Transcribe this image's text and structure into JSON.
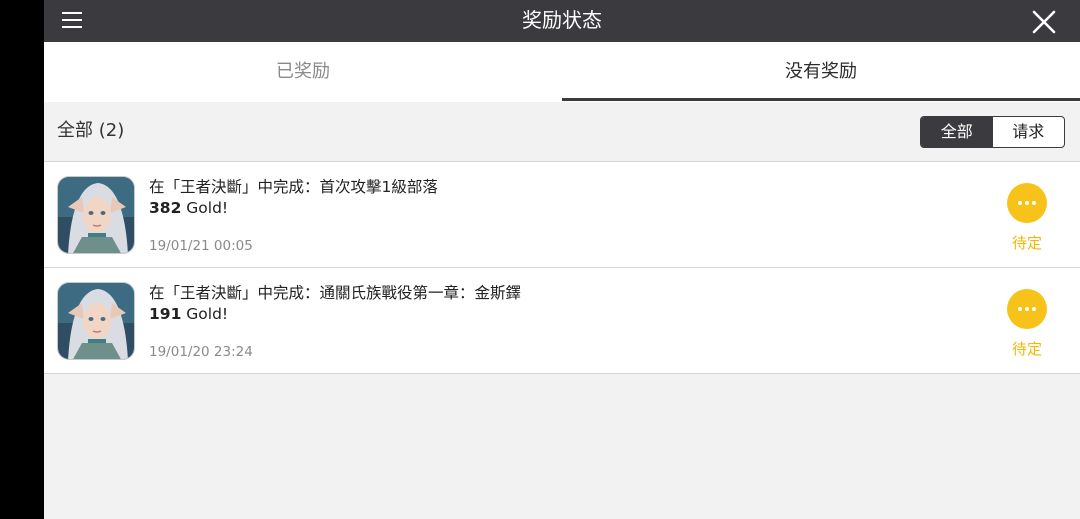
{
  "header": {
    "title": "奖励状态",
    "menu_icon": "hamburger-menu-icon",
    "close_icon": "close-icon"
  },
  "tabs": [
    {
      "label": "已奖励",
      "active": false
    },
    {
      "label": "没有奖励",
      "active": true
    }
  ],
  "filter": {
    "label": "全部 (2)",
    "options": [
      {
        "label": "全部",
        "active": true
      },
      {
        "label": "请求",
        "active": false
      }
    ]
  },
  "rewards": [
    {
      "title": "在「王者決斷」中完成：首次攻擊1級部落",
      "amount": "382",
      "currency": "Gold!",
      "date": "19/01/21 00:05",
      "status": "待定"
    },
    {
      "title": "在「王者決斷」中完成：通關氏族戰役第一章：金斯鐸",
      "amount": "191",
      "currency": "Gold!",
      "date": "19/01/20 23:24",
      "status": "待定"
    }
  ],
  "colors": {
    "titlebar": "#3b3b3f",
    "status_accent": "#f7c31a",
    "status_text": "#f2b705",
    "background": "#f2f2f2"
  }
}
